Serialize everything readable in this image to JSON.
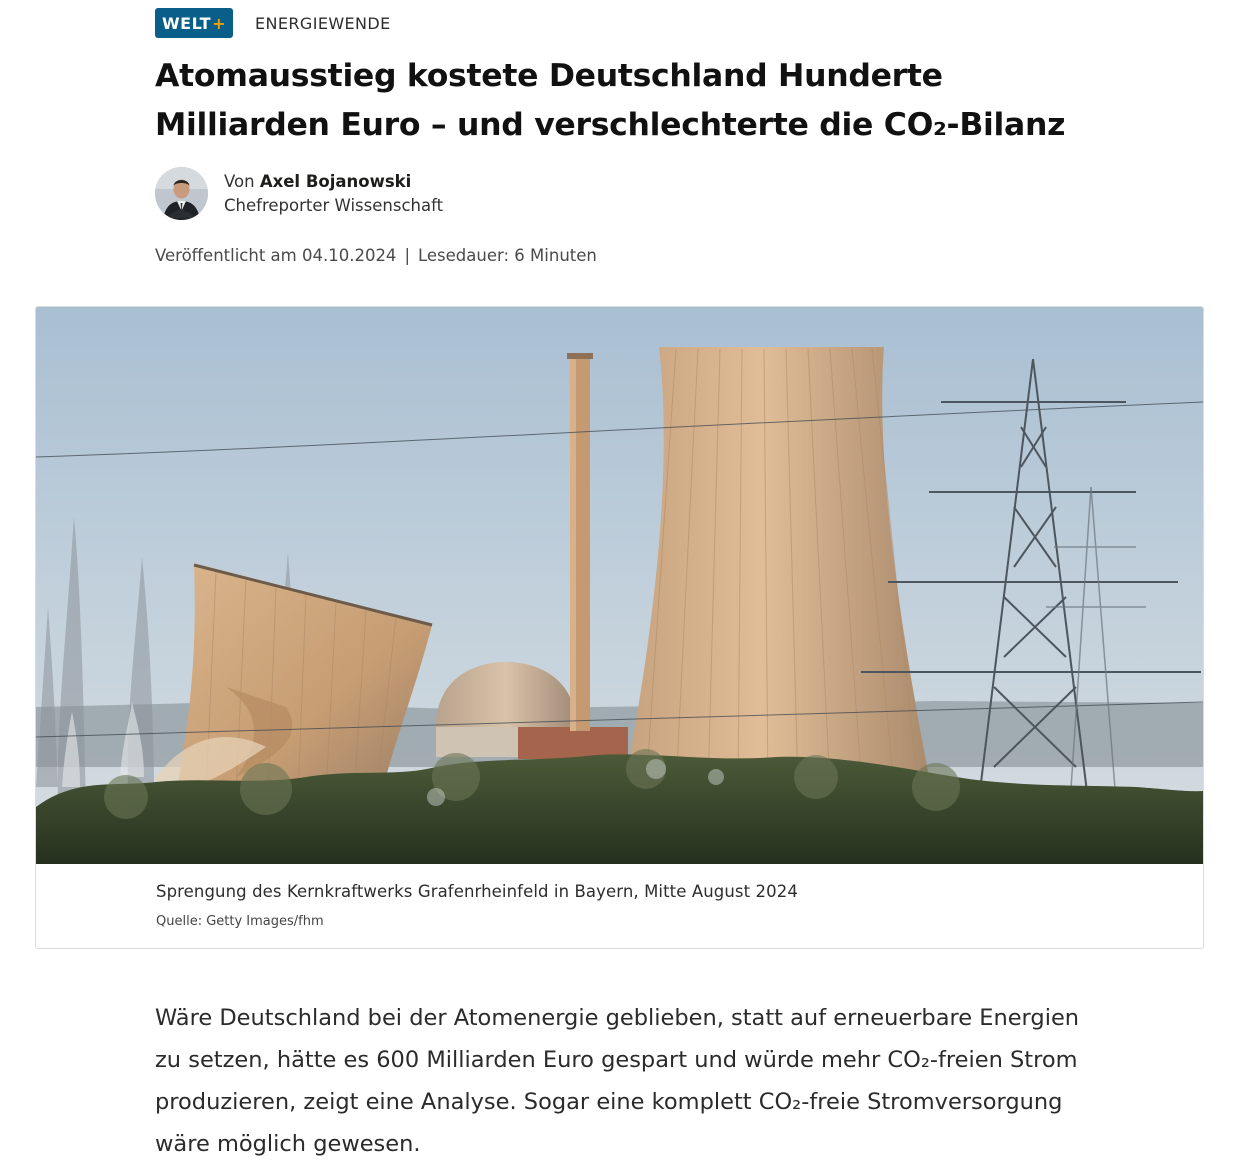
{
  "brand": {
    "badge_main": "WELT",
    "badge_plus": "+",
    "brand_color": "#0a5e8a",
    "plus_color": "#f5a000"
  },
  "article": {
    "category": "ENERGIEWENDE",
    "headline": "Atomausstieg kostete Deutschland Hunderte Milliarden Euro – und verschlechterte die CO₂-Bilanz",
    "author": {
      "by_prefix": "Von",
      "name": "Axel Bojanowski",
      "role": "Chefreporter Wissenschaft"
    },
    "meta": {
      "published": "Veröffentlicht am 04.10.2024",
      "separator": "|",
      "reading_time": "Lesedauer: 6 Minuten"
    },
    "image": {
      "caption": "Sprengung des Kernkraftwerks Grafenrheinfeld in Bayern, Mitte August 2024",
      "source": "Quelle: Getty Images/fhm"
    },
    "lead": "Wäre Deutschland bei der Atomenergie geblieben, statt auf erneuerbare Energien zu setzen, hätte es 600 Milliarden Euro gespart und würde mehr CO₂-freien Strom produzieren, zeigt eine Analyse. Sogar eine komplett CO₂-freie Stromversorgung wäre möglich gewesen."
  }
}
